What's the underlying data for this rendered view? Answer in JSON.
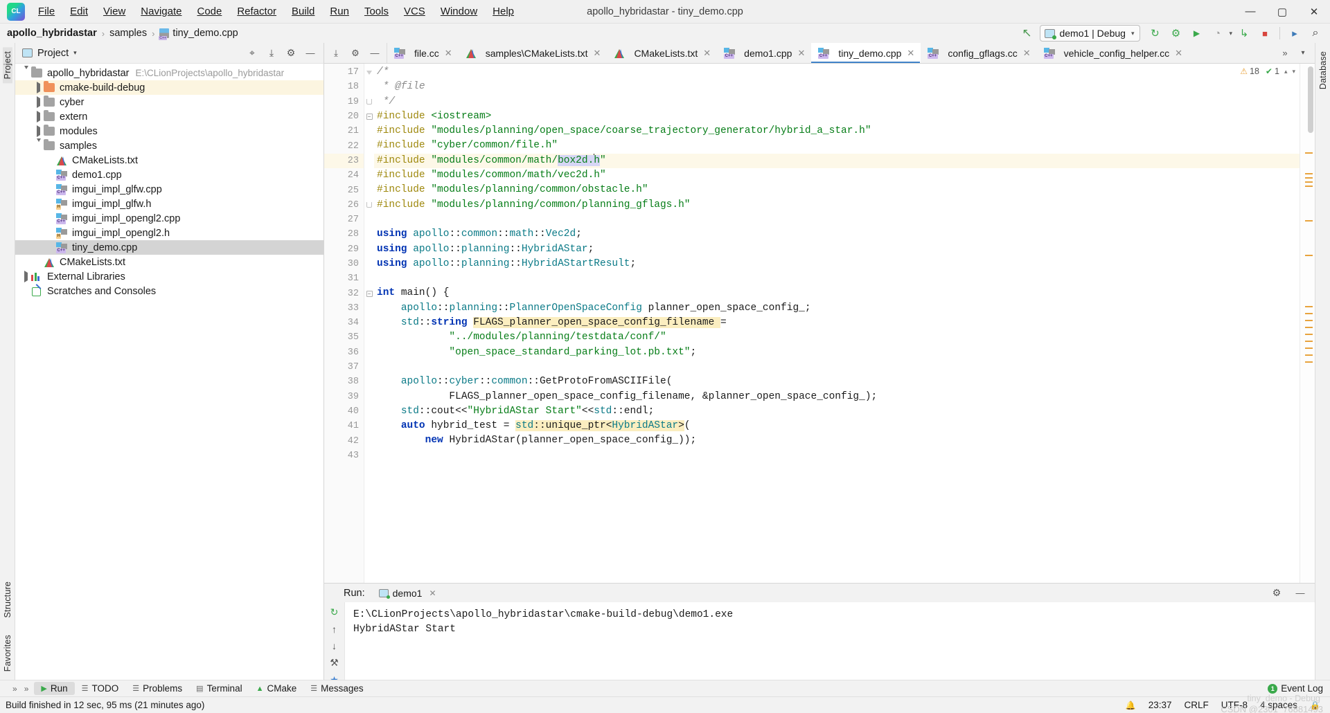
{
  "window": {
    "title": "apollo_hybridastar - tiny_demo.cpp",
    "app_icon": "clion-logo-icon",
    "minimize": "—",
    "maximize": "▢",
    "close": "✕"
  },
  "menubar": {
    "items": [
      {
        "label": "File"
      },
      {
        "label": "Edit"
      },
      {
        "label": "View"
      },
      {
        "label": "Navigate"
      },
      {
        "label": "Code"
      },
      {
        "label": "Refactor"
      },
      {
        "label": "Build"
      },
      {
        "label": "Run"
      },
      {
        "label": "Tools"
      },
      {
        "label": "VCS"
      },
      {
        "label": "Window"
      },
      {
        "label": "Help"
      }
    ]
  },
  "breadcrumb": {
    "items": [
      "apollo_hybridastar",
      "samples",
      "tiny_demo.cpp"
    ],
    "separator": "›"
  },
  "toolbar": {
    "back_arrow": "↖",
    "run_config": {
      "label": "demo1 | Debug",
      "caret": "▾"
    },
    "buttons": [
      {
        "name": "build-button",
        "glyph": "↻"
      },
      {
        "name": "debug-button",
        "glyph": "⚙"
      },
      {
        "name": "run-button",
        "glyph": "▶"
      },
      {
        "name": "run-with-coverage-button",
        "glyph": "◔"
      },
      {
        "name": "attach-to-process-button",
        "glyph": "↳"
      },
      {
        "name": "stop-button",
        "glyph": "■"
      },
      {
        "name": "terminal-button",
        "glyph": "▸"
      },
      {
        "name": "search-everywhere-button",
        "glyph": "⌕"
      }
    ]
  },
  "project_panel": {
    "title": "Project",
    "caret": "▾",
    "header_buttons": [
      {
        "name": "select-opened-file-button",
        "glyph": "⌖"
      },
      {
        "name": "collapse-all-button",
        "glyph": "⤓"
      },
      {
        "name": "settings-button",
        "glyph": "⚙"
      },
      {
        "name": "hide-button",
        "glyph": "—"
      }
    ],
    "tree": [
      {
        "label": "apollo_hybridastar",
        "path": "E:\\CLionProjects\\apollo_hybridastar",
        "icon": "folder-icon",
        "twist": "expanded",
        "indent": 0,
        "state": "normal"
      },
      {
        "label": "cmake-build-debug",
        "path": "",
        "icon": "folder-orange-icon",
        "twist": "collapsed",
        "indent": 1,
        "state": "highlight"
      },
      {
        "label": "cyber",
        "path": "",
        "icon": "folder-icon",
        "twist": "collapsed",
        "indent": 1,
        "state": "normal"
      },
      {
        "label": "extern",
        "path": "",
        "icon": "folder-icon",
        "twist": "collapsed",
        "indent": 1,
        "state": "normal"
      },
      {
        "label": "modules",
        "path": "",
        "icon": "folder-icon",
        "twist": "collapsed",
        "indent": 1,
        "state": "normal"
      },
      {
        "label": "samples",
        "path": "",
        "icon": "folder-icon",
        "twist": "expanded",
        "indent": 1,
        "state": "normal"
      },
      {
        "label": "CMakeLists.txt",
        "path": "",
        "icon": "cmake-icon",
        "twist": "none",
        "indent": 2,
        "state": "normal"
      },
      {
        "label": "demo1.cpp",
        "path": "",
        "icon": "cpp-file-icon",
        "twist": "none",
        "indent": 2,
        "state": "normal"
      },
      {
        "label": "imgui_impl_glfw.cpp",
        "path": "",
        "icon": "cpp-file-icon",
        "twist": "none",
        "indent": 2,
        "state": "normal"
      },
      {
        "label": "imgui_impl_glfw.h",
        "path": "",
        "icon": "h-file-icon",
        "twist": "none",
        "indent": 2,
        "state": "normal"
      },
      {
        "label": "imgui_impl_opengl2.cpp",
        "path": "",
        "icon": "cpp-file-icon",
        "twist": "none",
        "indent": 2,
        "state": "normal"
      },
      {
        "label": "imgui_impl_opengl2.h",
        "path": "",
        "icon": "h-file-icon",
        "twist": "none",
        "indent": 2,
        "state": "normal"
      },
      {
        "label": "tiny_demo.cpp",
        "path": "",
        "icon": "cpp-file-icon",
        "twist": "none",
        "indent": 2,
        "state": "selected"
      },
      {
        "label": "CMakeLists.txt",
        "path": "",
        "icon": "cmake-icon",
        "twist": "none",
        "indent": 1,
        "state": "normal"
      },
      {
        "label": "External Libraries",
        "path": "",
        "icon": "library-icon",
        "twist": "collapsed",
        "indent": 0,
        "state": "normal"
      },
      {
        "label": "Scratches and Consoles",
        "path": "",
        "icon": "scratches-icon",
        "twist": "none",
        "indent": 0,
        "state": "normal"
      }
    ]
  },
  "rail": {
    "left_top": "Project",
    "left_bottom": [
      "Structure",
      "Favorites"
    ],
    "right": "Database"
  },
  "editor_tabs": {
    "tools": [
      {
        "name": "expand-collapse-button",
        "glyph": "⤓"
      },
      {
        "name": "settings-gear-button",
        "glyph": "⚙"
      },
      {
        "name": "hide-panel-button",
        "glyph": "—"
      }
    ],
    "tabs": [
      {
        "label": "file.cc",
        "icon": "cpp-file-icon",
        "active": false
      },
      {
        "label": "samples\\CMakeLists.txt",
        "icon": "cmake-icon",
        "active": false
      },
      {
        "label": "CMakeLists.txt",
        "icon": "cmake-icon",
        "active": false
      },
      {
        "label": "demo1.cpp",
        "icon": "cpp-file-icon",
        "active": false
      },
      {
        "label": "tiny_demo.cpp",
        "icon": "cpp-file-icon",
        "active": true
      },
      {
        "label": "config_gflags.cc",
        "icon": "cpp-file-icon",
        "active": false
      },
      {
        "label": "vehicle_config_helper.cc",
        "icon": "cpp-file-icon",
        "active": false
      }
    ],
    "close_glyph": "✕",
    "overflow_glyph": "»",
    "dropdown_glyph": "▾"
  },
  "inspection": {
    "warning_glyph": "⚠",
    "warning_count": "18",
    "ok_glyph": "✔",
    "ok_count": "1",
    "caret_up": "▴",
    "caret_down": "▾"
  },
  "editor": {
    "first_line": 17,
    "current_line": 23,
    "lines": [
      {
        "n": 17,
        "fold": "cmtop",
        "tokens": [
          {
            "t": "/*",
            "c": "cmt"
          }
        ]
      },
      {
        "n": 18,
        "fold": "",
        "tokens": [
          {
            "t": " * @file",
            "c": "cmt"
          }
        ]
      },
      {
        "n": 19,
        "fold": "cmend",
        "tokens": [
          {
            "t": " */",
            "c": "cmt"
          }
        ]
      },
      {
        "n": 20,
        "fold": "minus",
        "tokens": [
          {
            "t": "#include",
            "c": "pp"
          },
          {
            "t": " ",
            "c": "plain"
          },
          {
            "t": "<iostream>",
            "c": "str"
          }
        ]
      },
      {
        "n": 21,
        "fold": "",
        "tokens": [
          {
            "t": "#include",
            "c": "pp"
          },
          {
            "t": " ",
            "c": "plain"
          },
          {
            "t": "\"modules/planning/open_space/coarse_trajectory_generator/hybrid_a_star.h\"",
            "c": "str"
          }
        ]
      },
      {
        "n": 22,
        "fold": "",
        "tokens": [
          {
            "t": "#include",
            "c": "pp"
          },
          {
            "t": " ",
            "c": "plain"
          },
          {
            "t": "\"cyber/common/file.h\"",
            "c": "str"
          }
        ]
      },
      {
        "n": 23,
        "fold": "",
        "current": true,
        "tokens": [
          {
            "t": "#include",
            "c": "pp"
          },
          {
            "t": " ",
            "c": "plain"
          },
          {
            "t": "\"modules/common/math/",
            "c": "str"
          },
          {
            "t": "box2d.",
            "c": "str hl-sel"
          },
          {
            "t": "CARET",
            "c": "caret"
          },
          {
            "t": "h",
            "c": "str hl-sel"
          },
          {
            "t": "\"",
            "c": "str"
          }
        ]
      },
      {
        "n": 24,
        "fold": "",
        "tokens": [
          {
            "t": "#include",
            "c": "pp"
          },
          {
            "t": " ",
            "c": "plain"
          },
          {
            "t": "\"modules/common/math/vec2d.h\"",
            "c": "str"
          }
        ]
      },
      {
        "n": 25,
        "fold": "",
        "tokens": [
          {
            "t": "#include",
            "c": "pp"
          },
          {
            "t": " ",
            "c": "plain"
          },
          {
            "t": "\"modules/planning/common/obstacle.h\"",
            "c": "str"
          }
        ]
      },
      {
        "n": 26,
        "fold": "cmend",
        "tokens": [
          {
            "t": "#include",
            "c": "pp"
          },
          {
            "t": " ",
            "c": "plain"
          },
          {
            "t": "\"modules/planning/common/planning_gflags.h\"",
            "c": "str"
          }
        ]
      },
      {
        "n": 27,
        "fold": "",
        "tokens": []
      },
      {
        "n": 28,
        "fold": "",
        "tokens": [
          {
            "t": "using",
            "c": "kw"
          },
          {
            "t": " ",
            "c": "plain"
          },
          {
            "t": "apollo",
            "c": "type"
          },
          {
            "t": "::",
            "c": "plain"
          },
          {
            "t": "common",
            "c": "type"
          },
          {
            "t": "::",
            "c": "plain"
          },
          {
            "t": "math",
            "c": "type"
          },
          {
            "t": "::",
            "c": "plain"
          },
          {
            "t": "Vec2d",
            "c": "type"
          },
          {
            "t": ";",
            "c": "plain"
          }
        ]
      },
      {
        "n": 29,
        "fold": "",
        "tokens": [
          {
            "t": "using",
            "c": "kw"
          },
          {
            "t": " ",
            "c": "plain"
          },
          {
            "t": "apollo",
            "c": "type"
          },
          {
            "t": "::",
            "c": "plain"
          },
          {
            "t": "planning",
            "c": "type"
          },
          {
            "t": "::",
            "c": "plain"
          },
          {
            "t": "HybridAStar",
            "c": "type"
          },
          {
            "t": ";",
            "c": "plain"
          }
        ]
      },
      {
        "n": 30,
        "fold": "",
        "tokens": [
          {
            "t": "using",
            "c": "kw"
          },
          {
            "t": " ",
            "c": "plain"
          },
          {
            "t": "apollo",
            "c": "type"
          },
          {
            "t": "::",
            "c": "plain"
          },
          {
            "t": "planning",
            "c": "type"
          },
          {
            "t": "::",
            "c": "plain"
          },
          {
            "t": "HybridAStartResult",
            "c": "type"
          },
          {
            "t": ";",
            "c": "plain"
          }
        ]
      },
      {
        "n": 31,
        "fold": "",
        "tokens": []
      },
      {
        "n": 32,
        "fold": "minus",
        "runmark": true,
        "tokens": [
          {
            "t": "int",
            "c": "kw"
          },
          {
            "t": " ",
            "c": "plain"
          },
          {
            "t": "main",
            "c": "ident"
          },
          {
            "t": "() {",
            "c": "plain"
          }
        ]
      },
      {
        "n": 33,
        "fold": "",
        "tokens": [
          {
            "t": "    ",
            "c": "plain"
          },
          {
            "t": "apollo",
            "c": "type"
          },
          {
            "t": "::",
            "c": "plain"
          },
          {
            "t": "planning",
            "c": "type"
          },
          {
            "t": "::",
            "c": "plain"
          },
          {
            "t": "PlannerOpenSpaceConfig",
            "c": "type"
          },
          {
            "t": " planner_open_space_config_;",
            "c": "plain"
          }
        ]
      },
      {
        "n": 34,
        "fold": "",
        "tokens": [
          {
            "t": "    ",
            "c": "plain"
          },
          {
            "t": "std",
            "c": "type"
          },
          {
            "t": "::",
            "c": "plain"
          },
          {
            "t": "string",
            "c": "kw"
          },
          {
            "t": " ",
            "c": "plain"
          },
          {
            "t": "FLAGS_planner_open_space_config_filename ",
            "c": "plain hl-ident"
          },
          {
            "t": "=",
            "c": "plain"
          }
        ]
      },
      {
        "n": 35,
        "fold": "",
        "tokens": [
          {
            "t": "            ",
            "c": "plain"
          },
          {
            "t": "\"../modules/planning/testdata/conf/\"",
            "c": "str"
          }
        ]
      },
      {
        "n": 36,
        "fold": "",
        "tokens": [
          {
            "t": "            ",
            "c": "plain"
          },
          {
            "t": "\"open_space_standard_parking_lot.pb.txt\"",
            "c": "str"
          },
          {
            "t": ";",
            "c": "plain"
          }
        ]
      },
      {
        "n": 37,
        "fold": "",
        "tokens": []
      },
      {
        "n": 38,
        "fold": "",
        "tokens": [
          {
            "t": "    ",
            "c": "plain"
          },
          {
            "t": "apollo",
            "c": "type"
          },
          {
            "t": "::",
            "c": "plain"
          },
          {
            "t": "cyber",
            "c": "type"
          },
          {
            "t": "::",
            "c": "plain"
          },
          {
            "t": "common",
            "c": "type"
          },
          {
            "t": "::",
            "c": "plain"
          },
          {
            "t": "GetProtoFromASCIIFile",
            "c": "ident"
          },
          {
            "t": "(",
            "c": "plain"
          }
        ]
      },
      {
        "n": 39,
        "fold": "",
        "tokens": [
          {
            "t": "            FLAGS_planner_open_space_config_filename, &planner_open_space_config_);",
            "c": "plain"
          }
        ]
      },
      {
        "n": 40,
        "fold": "",
        "tokens": [
          {
            "t": "    ",
            "c": "plain"
          },
          {
            "t": "std",
            "c": "type"
          },
          {
            "t": "::",
            "c": "plain"
          },
          {
            "t": "cout",
            "c": "ident"
          },
          {
            "t": "<<",
            "c": "plain"
          },
          {
            "t": "\"HybridAStar Start\"",
            "c": "str"
          },
          {
            "t": "<<",
            "c": "plain"
          },
          {
            "t": "std",
            "c": "type"
          },
          {
            "t": "::",
            "c": "plain"
          },
          {
            "t": "endl",
            "c": "ident"
          },
          {
            "t": ";",
            "c": "plain"
          }
        ]
      },
      {
        "n": 41,
        "fold": "",
        "tokens": [
          {
            "t": "    ",
            "c": "plain"
          },
          {
            "t": "auto",
            "c": "kw"
          },
          {
            "t": " hybrid_test = ",
            "c": "plain"
          },
          {
            "t": "std",
            "c": "type hl-ident"
          },
          {
            "t": "::",
            "c": "plain hl-ident"
          },
          {
            "t": "unique_ptr",
            "c": "plain hl-ident"
          },
          {
            "t": "<",
            "c": "plain hl-ident"
          },
          {
            "t": "HybridAStar",
            "c": "type hl-ident"
          },
          {
            "t": ">",
            "c": "plain hl-ident"
          },
          {
            "t": "(",
            "c": "plain"
          }
        ]
      },
      {
        "n": 42,
        "fold": "",
        "tokens": [
          {
            "t": "        ",
            "c": "plain"
          },
          {
            "t": "new",
            "c": "kw"
          },
          {
            "t": " ",
            "c": "plain"
          },
          {
            "t": "HybridAStar",
            "c": "ident"
          },
          {
            "t": "(planner_open_space_config_));",
            "c": "plain"
          }
        ]
      },
      {
        "n": 43,
        "fold": "",
        "tokens": []
      }
    ]
  },
  "run_window": {
    "label": "Run:",
    "tab": "demo1",
    "close_glyph": "✕",
    "settings_glyph": "⚙",
    "hide_glyph": "—",
    "side_buttons": [
      {
        "name": "rerun-button",
        "glyph": "↻"
      },
      {
        "name": "scroll-up-button",
        "glyph": "↑"
      },
      {
        "name": "scroll-down-button",
        "glyph": "↓"
      },
      {
        "name": "wrench-button",
        "glyph": "⚒"
      },
      {
        "name": "pin-button",
        "glyph": "★"
      },
      {
        "name": "expand-left-button",
        "glyph": "»"
      },
      {
        "name": "expand-right-button",
        "glyph": "»"
      }
    ],
    "console": [
      "E:\\CLionProjects\\apollo_hybridastar\\cmake-build-debug\\demo1.exe",
      "HybridAStar Start"
    ]
  },
  "bottom_bar": {
    "items": [
      {
        "label": "Run",
        "icon": "run-icon",
        "active": true
      },
      {
        "label": "TODO",
        "icon": "todo-icon",
        "active": false
      },
      {
        "label": "Problems",
        "icon": "problems-icon",
        "active": false
      },
      {
        "label": "Terminal",
        "icon": "terminal-icon",
        "active": false
      },
      {
        "label": "CMake",
        "icon": "cmake-icon",
        "active": false
      },
      {
        "label": "Messages",
        "icon": "messages-icon",
        "active": false
      }
    ],
    "event_log": {
      "label": "Event Log",
      "count": "1"
    }
  },
  "status_bar": {
    "message": "Build finished in 12 sec, 95 ms (21 minutes ago)",
    "notification_glyph": "🔔",
    "time": "23:37",
    "line_separator": "CRLF",
    "encoding": "UTF-8",
    "indent": "4 spaces",
    "lock_glyph": "🔒"
  },
  "watermark": {
    "line1": "CSDN @2301_76881493",
    "line2": "tiny_demo - Debug"
  }
}
